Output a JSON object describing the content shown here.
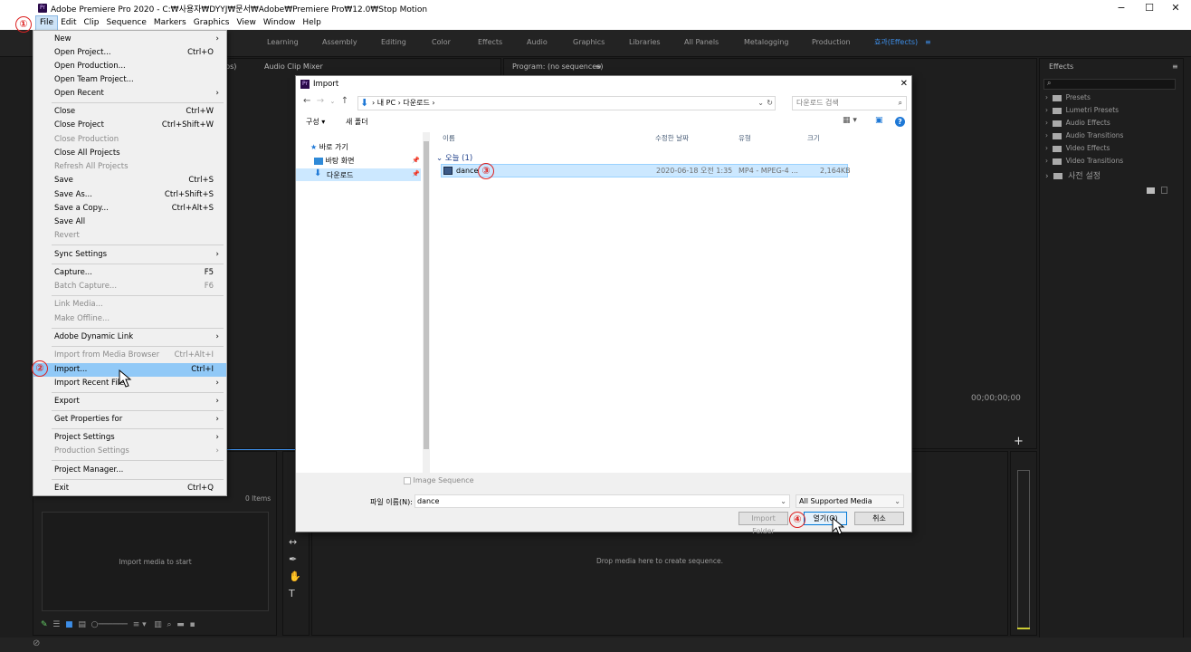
{
  "titlebar": {
    "title": "Adobe Premiere Pro 2020 - C:₩사용자₩DYYJ₩문서₩Adobe₩Premiere Pro₩12.0₩Stop Motion",
    "app_icon": "Pr",
    "minimize": "−",
    "maximize": "☐",
    "close": "✕"
  },
  "menubar": [
    "File",
    "Edit",
    "Clip",
    "Sequence",
    "Markers",
    "Graphics",
    "View",
    "Window",
    "Help"
  ],
  "workspaces": [
    "Learning",
    "Assembly",
    "Editing",
    "Color",
    "Effects",
    "Audio",
    "Graphics",
    "Libraries",
    "All Panels",
    "Metalogging",
    "Production",
    "효과(Effects)"
  ],
  "workspace_menu_icon": "≡",
  "panels": {
    "source_tab_partial": "ps)",
    "audio_clip_mixer": "Audio Clip Mixer",
    "program": "Program: (no sequences)",
    "program_menu": "≡",
    "program_timecode": "00;00;00;00",
    "project_items": "0 Items",
    "project_empty": "Import media to start",
    "timeline_empty": "Drop media here to create sequence.",
    "effects_title": "Effects",
    "effects_menu": "≡",
    "effects_items": [
      "Presets",
      "Lumetri Presets",
      "Audio Effects",
      "Audio Transitions",
      "Video Effects",
      "Video Transitions",
      "사전 설정"
    ]
  },
  "file_menu": [
    {
      "label": "New",
      "shortcut": "",
      "arrow": true,
      "disabled": false
    },
    {
      "label": "Open Project...",
      "shortcut": "Ctrl+O",
      "arrow": false,
      "disabled": false
    },
    {
      "label": "Open Production...",
      "shortcut": "",
      "arrow": false,
      "disabled": false
    },
    {
      "label": "Open Team Project...",
      "shortcut": "",
      "arrow": false,
      "disabled": false
    },
    {
      "label": "Open Recent",
      "shortcut": "",
      "arrow": true,
      "disabled": false
    },
    {
      "label": "Close",
      "shortcut": "Ctrl+W",
      "arrow": false,
      "disabled": false
    },
    {
      "label": "Close Project",
      "shortcut": "Ctrl+Shift+W",
      "arrow": false,
      "disabled": false
    },
    {
      "label": "Close Production",
      "shortcut": "",
      "arrow": false,
      "disabled": true
    },
    {
      "label": "Close All Projects",
      "shortcut": "",
      "arrow": false,
      "disabled": false
    },
    {
      "label": "Refresh All Projects",
      "shortcut": "",
      "arrow": false,
      "disabled": true
    },
    {
      "label": "Save",
      "shortcut": "Ctrl+S",
      "arrow": false,
      "disabled": false
    },
    {
      "label": "Save As...",
      "shortcut": "Ctrl+Shift+S",
      "arrow": false,
      "disabled": false
    },
    {
      "label": "Save a Copy...",
      "shortcut": "Ctrl+Alt+S",
      "arrow": false,
      "disabled": false
    },
    {
      "label": "Save All",
      "shortcut": "",
      "arrow": false,
      "disabled": false
    },
    {
      "label": "Revert",
      "shortcut": "",
      "arrow": false,
      "disabled": true
    },
    {
      "label": "Sync Settings",
      "shortcut": "",
      "arrow": true,
      "disabled": false
    },
    {
      "label": "Capture...",
      "shortcut": "F5",
      "arrow": false,
      "disabled": false
    },
    {
      "label": "Batch Capture...",
      "shortcut": "F6",
      "arrow": false,
      "disabled": true
    },
    {
      "label": "Link Media...",
      "shortcut": "",
      "arrow": false,
      "disabled": true
    },
    {
      "label": "Make Offline...",
      "shortcut": "",
      "arrow": false,
      "disabled": true
    },
    {
      "label": "Adobe Dynamic Link",
      "shortcut": "",
      "arrow": true,
      "disabled": false
    },
    {
      "label": "Import from Media Browser",
      "shortcut": "Ctrl+Alt+I",
      "arrow": false,
      "disabled": true
    },
    {
      "label": "Import...",
      "shortcut": "Ctrl+I",
      "arrow": false,
      "disabled": false,
      "highlighted": true
    },
    {
      "label": "Import Recent File",
      "shortcut": "",
      "arrow": true,
      "disabled": false
    },
    {
      "label": "Export",
      "shortcut": "",
      "arrow": true,
      "disabled": false
    },
    {
      "label": "Get Properties for",
      "shortcut": "",
      "arrow": true,
      "disabled": false
    },
    {
      "label": "Project Settings",
      "shortcut": "",
      "arrow": true,
      "disabled": false
    },
    {
      "label": "Production Settings",
      "shortcut": "",
      "arrow": true,
      "disabled": true
    },
    {
      "label": "Project Manager...",
      "shortcut": "",
      "arrow": false,
      "disabled": false
    },
    {
      "label": "Exit",
      "shortcut": "Ctrl+Q",
      "arrow": false,
      "disabled": false
    }
  ],
  "dialog": {
    "title": "Import",
    "breadcrumb": [
      "내 PC",
      "다운로드"
    ],
    "search_placeholder": "다운로드 검색",
    "organize": "구성 ▾",
    "new_folder": "새 폴더",
    "nav": [
      "바로 가기",
      "바탕 화면",
      "다운로드"
    ],
    "columns": [
      "이름",
      "수정한 날짜",
      "유형",
      "크기"
    ],
    "group": "오늘 (1)",
    "file": {
      "name": "dance",
      "date": "2020-06-18 오전 1:35",
      "type": "MP4 - MPEG-4 ...",
      "size": "2,164KB"
    },
    "image_sequence": "Image Sequence",
    "filename_label": "파일 이름(N):",
    "filename_value": "dance",
    "filter": "All Supported Media",
    "import_folder": "Import Folder",
    "open": "열기(O)",
    "cancel": "취소",
    "close": "✕",
    "help": "?"
  },
  "annotations": [
    "①",
    "②",
    "③",
    "④"
  ],
  "colors": {
    "accent": "#3d8ee8",
    "highlight": "#91c9f7",
    "annotation": "#dd2222"
  }
}
